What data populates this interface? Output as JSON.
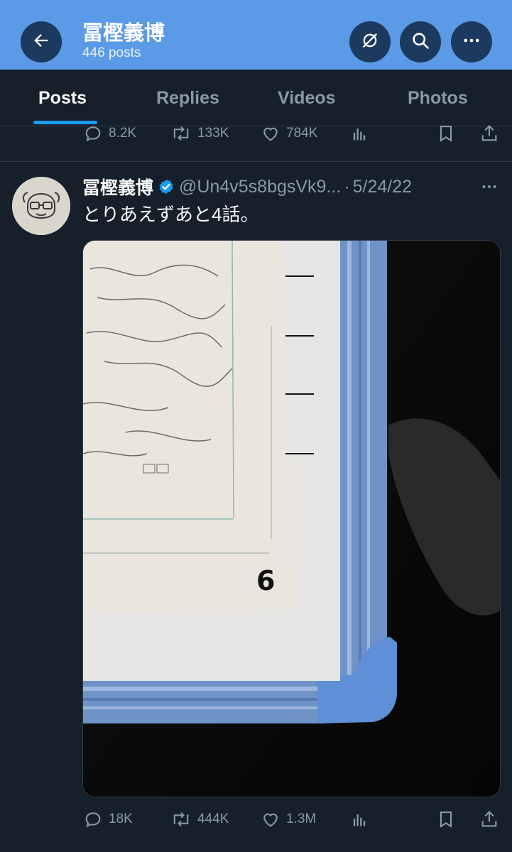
{
  "header": {
    "title": "冨樫義博",
    "post_count": "446 posts",
    "icons": [
      "back-arrow-icon",
      "premium-slash-icon",
      "search-icon",
      "more-icon"
    ]
  },
  "tabs": [
    {
      "label": "Posts",
      "active": true
    },
    {
      "label": "Replies",
      "active": false
    },
    {
      "label": "Videos",
      "active": false
    },
    {
      "label": "Photos",
      "active": false
    }
  ],
  "previous_post": {
    "replies": "8.2K",
    "reposts": "133K",
    "likes": "784K"
  },
  "tweet": {
    "author_name": "冨樫義博",
    "handle": "@Un4v5s8bgsVk9...",
    "separator": "·",
    "date": "5/24/22",
    "text": "とりあえずあと4話。",
    "photo_number": "6",
    "stats": {
      "replies": "18K",
      "reposts": "444K",
      "likes": "1.3M"
    }
  },
  "colors": {
    "header_bg": "#5b9ae6",
    "background": "#15202b",
    "accent": "#1d9bf0",
    "muted_text": "#8b98a5"
  }
}
